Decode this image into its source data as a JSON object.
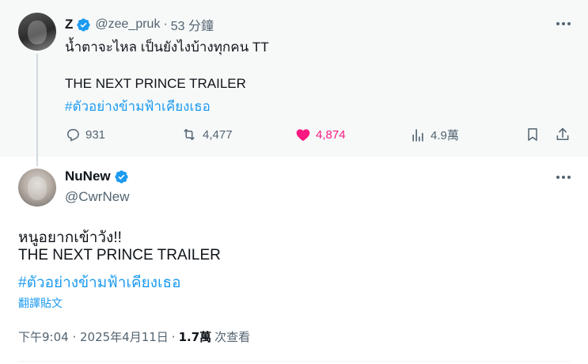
{
  "parent_tweet": {
    "display_name": "Z",
    "handle": "@zee_pruk",
    "time": "53 分鐘",
    "line1": "น้ำตาจะไหล เป็นยังไงบ้างทุกคน TT",
    "line3": "THE NEXT PRINCE TRAILER",
    "hashtag": "#ตัวอย่างข้ามฟ้าเคียงเธอ",
    "actions": {
      "replies": "931",
      "retweets": "4,477",
      "likes": "4,874",
      "views": "4.9萬"
    }
  },
  "main_tweet": {
    "display_name": "NuNew",
    "handle": "@CwrNew",
    "line1": "หนูอยากเข้าวัง!!",
    "line2": "THE NEXT PRINCE TRAILER",
    "hashtag": "#ตัวอย่างข้ามฟ้าเคียงเธอ",
    "translate_label": "翻譯貼文",
    "timestamp": "下午9:04 · 2025年4月11日",
    "views_count": "1.7萬",
    "views_label": "次查看"
  },
  "colors": {
    "accent": "#1d9bf0",
    "like": "#f91880",
    "muted": "#536471",
    "parent_bg": "#f7f9f9"
  },
  "icons": [
    "verified-badge-icon",
    "more-icon",
    "reply-icon",
    "retweet-icon",
    "heart-icon",
    "views-icon",
    "bookmark-icon",
    "share-icon"
  ]
}
